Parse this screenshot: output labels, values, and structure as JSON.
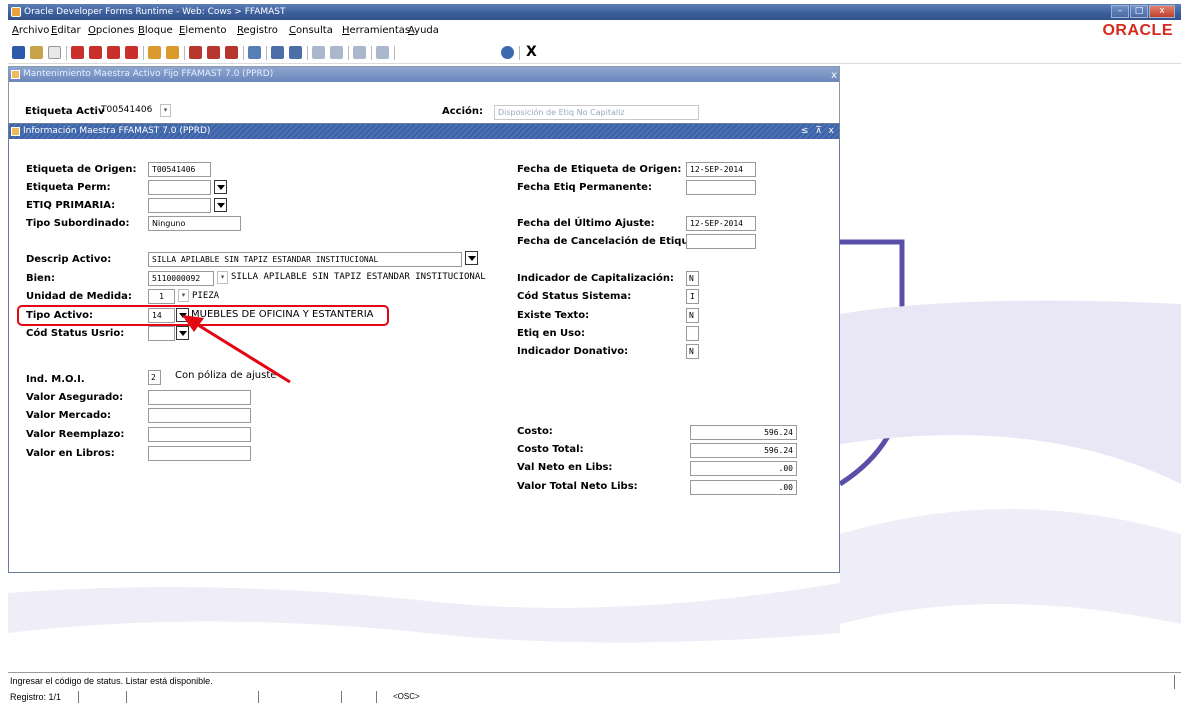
{
  "window": {
    "title": "Oracle Developer Forms Runtime - Web:  Cows > FFAMAST"
  },
  "menu": [
    "Archivo",
    "Editar",
    "Opciones",
    "Bloque",
    "Elemento",
    "Registro",
    "Consulta",
    "Herramientas",
    "Ayuda"
  ],
  "brand": {
    "logo_text": "ORACLE",
    "color": "#d52b1e"
  },
  "toolbar": {
    "exit_label": "X"
  },
  "parent_form": {
    "title": "Mantenimiento Maestra Activo Fijo  FFAMAST  7.0  (PPRD)",
    "etiqueta_label": "Etiqueta Activ",
    "etiqueta_value": "T00541406",
    "accion_label": "Acción:",
    "accion_value": "Disposición de Etiq No Capitaliz"
  },
  "child_form": {
    "title": "Información Maestra  FFAMAST  7.0  (PPRD)",
    "left": {
      "etiqueta_origen": {
        "label": "Etiqueta de Origen:",
        "value": "T00541406"
      },
      "etiqueta_perm": {
        "label": "Etiqueta Perm:",
        "value": ""
      },
      "etiq_primaria": {
        "label": "ETIQ PRIMARIA:",
        "value": ""
      },
      "tipo_subordinado": {
        "label": "Tipo Subordinado:",
        "value": "Ninguno"
      },
      "descrip_activo": {
        "label": "Descrip Activo:",
        "value": "SILLA APILABLE SIN TAPIZ ESTANDAR INSTITUCIONAL"
      },
      "bien": {
        "label": "Bien:",
        "code": "5110000092",
        "desc": "SILLA APILABLE SIN TAPIZ ESTANDAR INSTITUCIONAL"
      },
      "unidad_medida": {
        "label": "Unidad de Medida:",
        "code": "1",
        "desc": "PIEZA"
      },
      "tipo_activo": {
        "label": "Tipo Activo:",
        "code": "14",
        "desc": "MUEBLES DE OFICINA Y ESTANTERIA"
      },
      "cod_status_usrio": {
        "label": "Cód Status Usrio:",
        "value": ""
      },
      "ind_moi": {
        "label": "Ind. M.O.I.",
        "code": "2",
        "desc": "Con póliza de ajuste"
      },
      "valor_asegurado": {
        "label": "Valor Asegurado:",
        "value": ""
      },
      "valor_mercado": {
        "label": "Valor Mercado:",
        "value": ""
      },
      "valor_reemplazo": {
        "label": "Valor Reemplazo:",
        "value": ""
      },
      "valor_libros": {
        "label": "Valor en Libros:",
        "value": ""
      }
    },
    "right": {
      "fecha_etiqueta_origen": {
        "label": "Fecha de Etiqueta de Origen:",
        "value": "12-SEP-2014"
      },
      "fecha_etiq_permanente": {
        "label": "Fecha Etiq Permanente:",
        "value": ""
      },
      "fecha_ultimo_ajuste": {
        "label": "Fecha del Último Ajuste:",
        "value": "12-SEP-2014"
      },
      "fecha_cancelacion": {
        "label": "Fecha de Cancelación de Etiqu",
        "value": ""
      },
      "indicador_capitalizacion": {
        "label": "Indicador de Capitalización:",
        "value": "N"
      },
      "cod_status_sistema": {
        "label": "Cód Status Sistema:",
        "value": "I"
      },
      "existe_texto": {
        "label": "Existe Texto:",
        "value": "N"
      },
      "etiq_en_uso": {
        "label": "Etiq en Uso:",
        "value": ""
      },
      "indicador_donativo": {
        "label": "Indicador Donativo:",
        "value": "N"
      },
      "costo": {
        "label": "Costo:",
        "value": "596.24"
      },
      "costo_total": {
        "label": "Costo Total:",
        "value": "596.24"
      },
      "val_neto_libs": {
        "label": "Val Neto en Libs:",
        "value": ".00"
      },
      "valor_total_neto": {
        "label": "Valor Total Neto Libs:",
        "value": ".00"
      }
    }
  },
  "status": {
    "message": "Ingresar el código de status. Listar está disponible.",
    "record": "Registro: 1/1",
    "osc": "<OSC>"
  },
  "colors": {
    "highlight": "#e30613",
    "bg_art": "#5a4fa8"
  }
}
